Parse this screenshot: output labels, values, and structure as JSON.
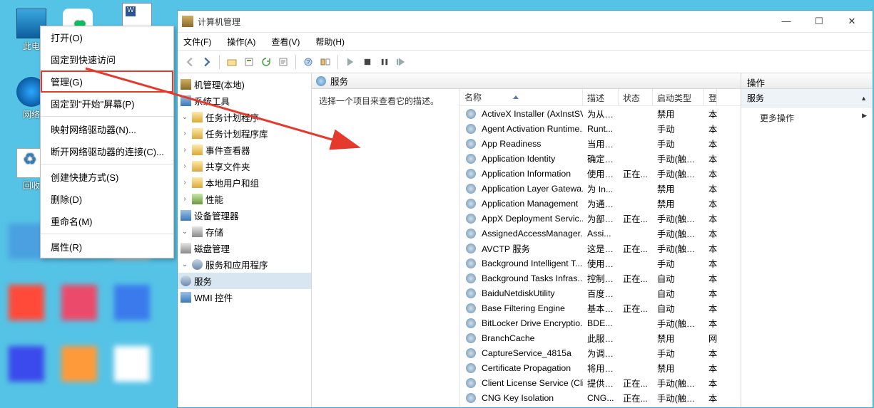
{
  "desktop": {
    "this_pc": "此电",
    "net": "网络",
    "recycle": "回收"
  },
  "context_menu": {
    "open": "打开(O)",
    "pin_quick": "固定到快速访问",
    "manage": "管理(G)",
    "pin_start": "固定到\"开始\"屏幕(P)",
    "map_net": "映射网络驱动器(N)...",
    "disconnect_net": "断开网络驱动器的连接(C)...",
    "create_shortcut": "创建快捷方式(S)",
    "delete": "删除(D)",
    "rename": "重命名(M)",
    "properties": "属性(R)"
  },
  "window": {
    "title": "计算机管理",
    "menus": {
      "file": "文件(F)",
      "action": "操作(A)",
      "view": "查看(V)",
      "help": "帮助(H)"
    }
  },
  "tree": {
    "root": "机管理(本地)",
    "sys_tools": "系统工具",
    "task_sched": "任务计划程序",
    "task_lib": "任务计划程序库",
    "event_viewer": "事件查看器",
    "shared": "共享文件夹",
    "local_users": "本地用户和组",
    "perf": "性能",
    "dev_mgr": "设备管理器",
    "storage": "存储",
    "disk_mgmt": "磁盘管理",
    "svc_apps": "服务和应用程序",
    "services": "服务",
    "wmi": "WMI 控件"
  },
  "center": {
    "header": "服务",
    "detail_hint": "选择一个项目来查看它的描述。",
    "columns": {
      "name": "名称",
      "desc": "描述",
      "state": "状态",
      "start": "启动类型",
      "logon": "登"
    }
  },
  "services": [
    {
      "name": "ActiveX Installer (AxInstSV)",
      "desc": "为从 ...",
      "state": "",
      "start": "禁用",
      "logon": "本"
    },
    {
      "name": "Agent Activation Runtime...",
      "desc": "Runt...",
      "state": "",
      "start": "手动",
      "logon": "本"
    },
    {
      "name": "App Readiness",
      "desc": "当用 ...",
      "state": "",
      "start": "手动",
      "logon": "本"
    },
    {
      "name": "Application Identity",
      "desc": "确定 ...",
      "state": "",
      "start": "手动(触发...",
      "logon": "本"
    },
    {
      "name": "Application Information",
      "desc": "使用 ...",
      "state": "正在...",
      "start": "手动(触发...",
      "logon": "本"
    },
    {
      "name": "Application Layer Gatewa...",
      "desc": "为 In...",
      "state": "",
      "start": "禁用",
      "logon": "本"
    },
    {
      "name": "Application Management",
      "desc": "为通 ...",
      "state": "",
      "start": "禁用",
      "logon": "本"
    },
    {
      "name": "AppX Deployment Servic...",
      "desc": "为部 ...",
      "state": "正在...",
      "start": "手动(触发...",
      "logon": "本"
    },
    {
      "name": "AssignedAccessManager...",
      "desc": "Assi...",
      "state": "",
      "start": "手动(触发...",
      "logon": "本"
    },
    {
      "name": "AVCTP 服务",
      "desc": "这是 ...",
      "state": "正在...",
      "start": "手动(触发...",
      "logon": "本"
    },
    {
      "name": "Background Intelligent T...",
      "desc": "使用 ...",
      "state": "",
      "start": "手动",
      "logon": "本"
    },
    {
      "name": "Background Tasks Infras...",
      "desc": "控制 ...",
      "state": "正在...",
      "start": "自动",
      "logon": "本"
    },
    {
      "name": "BaiduNetdiskUtility",
      "desc": "百度 ...",
      "state": "",
      "start": "自动",
      "logon": "本"
    },
    {
      "name": "Base Filtering Engine",
      "desc": "基本 ...",
      "state": "正在...",
      "start": "自动",
      "logon": "本"
    },
    {
      "name": "BitLocker Drive Encryptio...",
      "desc": "BDE...",
      "state": "",
      "start": "手动(触发...",
      "logon": "本"
    },
    {
      "name": "BranchCache",
      "desc": "此服 ...",
      "state": "",
      "start": "禁用",
      "logon": "网"
    },
    {
      "name": "CaptureService_4815a",
      "desc": "为调 ...",
      "state": "",
      "start": "手动",
      "logon": "本"
    },
    {
      "name": "Certificate Propagation",
      "desc": "将用 ...",
      "state": "",
      "start": "禁用",
      "logon": "本"
    },
    {
      "name": "Client License Service (Cli...",
      "desc": "提供 ...",
      "state": "正在...",
      "start": "手动(触发...",
      "logon": "本"
    },
    {
      "name": "CNG Key Isolation",
      "desc": "CNG...",
      "state": "正在...",
      "start": "手动(触发...",
      "logon": "本"
    }
  ],
  "actions_pane": {
    "header": "操作",
    "section": "服务",
    "more": "更多操作"
  }
}
